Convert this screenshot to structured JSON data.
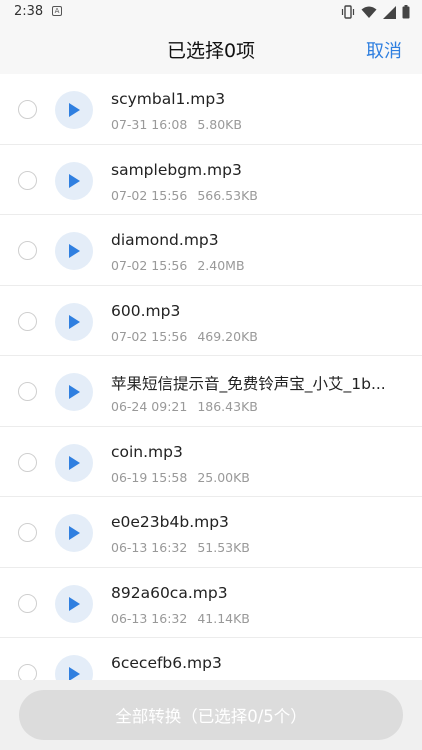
{
  "status_bar": {
    "time": "2:38",
    "notification_icon_letter": "A",
    "icons": [
      "vibrate-icon",
      "wifi-icon",
      "signal-icon",
      "battery-icon"
    ]
  },
  "header": {
    "title": "已选择0项",
    "cancel_label": "取消",
    "accent_color": "#2f7fe0"
  },
  "files": [
    {
      "name": "scymbal1.mp3",
      "date": "07-31 16:08",
      "size": "5.80KB"
    },
    {
      "name": "samplebgm.mp3",
      "date": "07-02 15:56",
      "size": "566.53KB"
    },
    {
      "name": "diamond.mp3",
      "date": "07-02 15:56",
      "size": "2.40MB"
    },
    {
      "name": "600.mp3",
      "date": "07-02 15:56",
      "size": "469.20KB"
    },
    {
      "name": "苹果短信提示音_免费铃声宝_小艾_1b...",
      "date": "06-24 09:21",
      "size": "186.43KB"
    },
    {
      "name": "coin.mp3",
      "date": "06-19 15:58",
      "size": "25.00KB"
    },
    {
      "name": "e0e23b4b.mp3",
      "date": "06-13 16:32",
      "size": "51.53KB"
    },
    {
      "name": "892a60ca.mp3",
      "date": "06-13 16:32",
      "size": "41.14KB"
    },
    {
      "name": "6cecefb6.mp3",
      "date": "",
      "size": ""
    }
  ],
  "bottom": {
    "convert_label": "全部转换（已选择0/5个）"
  }
}
